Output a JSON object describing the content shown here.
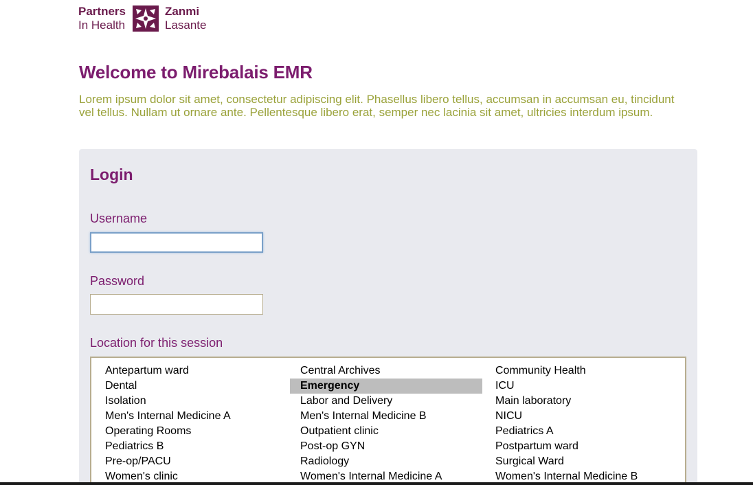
{
  "logo": {
    "left_line1": "Partners",
    "left_line2": "In Health",
    "right_line1": "Zanmi",
    "right_line2": "Lasante",
    "icon": "pih-logo-icon",
    "color": "#6a1a4c"
  },
  "welcome": {
    "title": "Welcome to Mirebalais EMR",
    "intro": "Lorem ipsum dolor sit amet, consectetur adipiscing elit. Phasellus libero tellus, accumsan in accumsan eu, tincidunt vel tellus. Nullam ut ornare ante. Pellentesque libero erat, semper nec lacinia sit amet, ultricies interdum ipsum."
  },
  "login": {
    "title": "Login",
    "username_label": "Username",
    "username_value": "",
    "password_label": "Password",
    "password_value": "",
    "location_label": "Location for this session",
    "selected_location": "Emergency",
    "locations": [
      "Antepartum ward",
      "Central Archives",
      "Community Health",
      "Dental",
      "Emergency",
      "ICU",
      "Isolation",
      "Labor and Delivery",
      "Main laboratory",
      "Men's Internal Medicine A",
      "Men's Internal Medicine B",
      "NICU",
      "Operating Rooms",
      "Outpatient clinic",
      "Pediatrics A",
      "Pediatrics B",
      "Post-op GYN",
      "Postpartum ward",
      "Pre-op/PACU",
      "Radiology",
      "Surgical Ward",
      "Women's clinic",
      "Women's Internal Medicine A",
      "Women's Internal Medicine B"
    ]
  },
  "colors": {
    "brand_purple": "#7c1d6e",
    "intro_olive": "#9aa23a",
    "panel_bg": "#e9eaef",
    "selected_bg": "#bdbdbd"
  }
}
